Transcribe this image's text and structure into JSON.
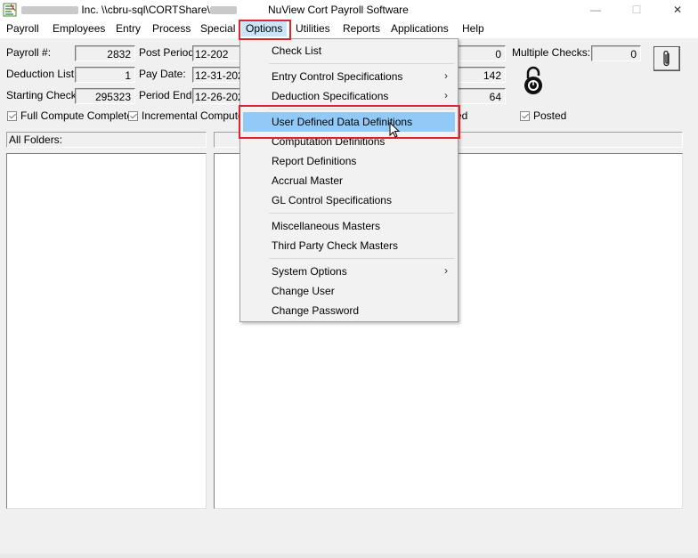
{
  "titlebar": {
    "left_text": "Inc. \\\\cbru-sql\\CORTShare\\",
    "app_title": "NuView Cort Payroll Software",
    "minimize": "—",
    "maximize": "☐",
    "close": "✕"
  },
  "menubar": {
    "items": [
      "Payroll",
      "Employees",
      "Entry",
      "Process",
      "Special",
      "Options",
      "Utilities",
      "Reports",
      "Applications",
      "Help"
    ]
  },
  "form": {
    "payroll_label": "Payroll #:",
    "payroll_value": "2832",
    "deduction_label": "Deduction List:",
    "deduction_value": "1",
    "starting_check_label": "Starting Check:",
    "starting_check_value": "295323",
    "post_period_label": "Post Period:",
    "post_period_value": "12-202",
    "pay_date_label": "Pay Date:",
    "pay_date_value": "12-31-202",
    "period_end_label": "Period End:",
    "period_end_value": "12-26-202",
    "right_field_1": "0",
    "right_field_2": "142",
    "right_field_3": "64",
    "multiple_checks_label": "Multiple Checks:",
    "multiple_checks_value": "0",
    "full_compute_label": "Full Compute Complete",
    "incremental_compute_label": "Incremental Compute C",
    "posted_partial_label": "ed",
    "posted_label": "Posted"
  },
  "panels": {
    "folders_header": "All Folders:"
  },
  "dropdown": {
    "items": [
      {
        "label": "Check List",
        "arrow": ""
      },
      {
        "label": "Entry Control Specifications",
        "arrow": "›"
      },
      {
        "label": "Deduction Specifications",
        "arrow": "›"
      },
      {
        "label": "User Defined Data Definitions",
        "arrow": ""
      },
      {
        "label": "Computation Definitions",
        "arrow": ""
      },
      {
        "label": "Report Definitions",
        "arrow": ""
      },
      {
        "label": "Accrual Master",
        "arrow": ""
      },
      {
        "label": "GL Control Specifications",
        "arrow": ""
      },
      {
        "label": "Miscellaneous Masters",
        "arrow": ""
      },
      {
        "label": "Third Party Check Masters",
        "arrow": ""
      },
      {
        "label": "System Options",
        "arrow": "›"
      },
      {
        "label": "Change User",
        "arrow": ""
      },
      {
        "label": "Change Password",
        "arrow": ""
      }
    ]
  },
  "colors": {
    "highlight": "#91c9f7",
    "annotation_red": "#e0242c"
  }
}
